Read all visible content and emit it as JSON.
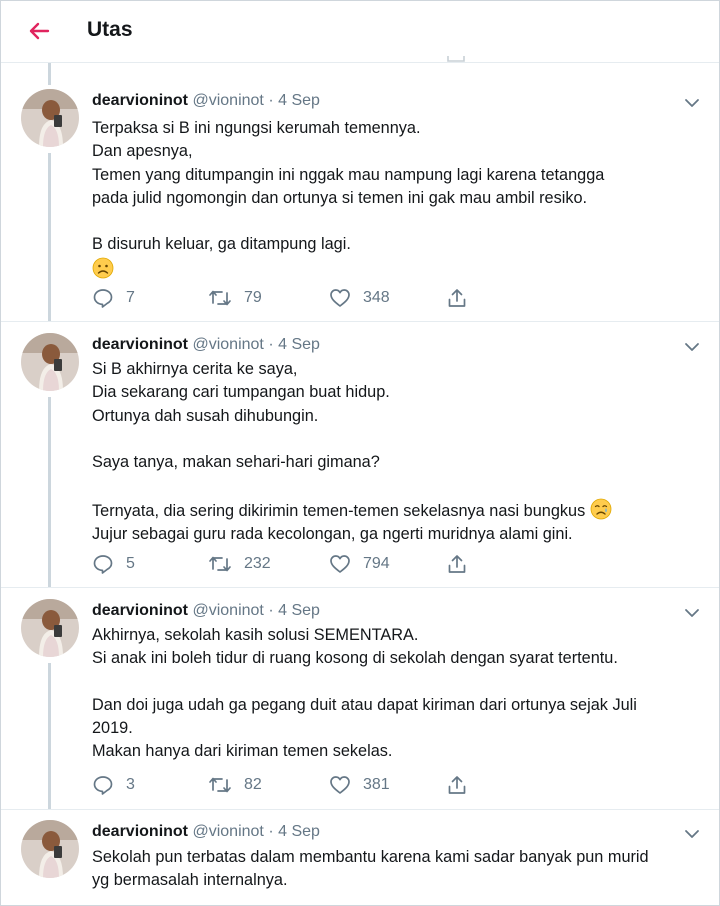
{
  "header": {
    "title": "Utas",
    "accent": "#e0245e"
  },
  "colors": {
    "meta": "#657786",
    "line": "#ccd6dd",
    "divider": "#e6ecf0"
  },
  "tweets": [
    {
      "name": "dearvioninot",
      "handle": "@vioninot",
      "date": "4 Sep",
      "lines": [
        "Terpaksa si B ini ngungsi kerumah temennya.",
        "Dan apesnya,",
        "Temen yang ditumpangin ini nggak mau nampung lagi karena tetangga",
        "pada julid ngomongin dan ortunya si temen ini gak mau ambil resiko.",
        "",
        "B disuruh keluar, ga ditampung lagi."
      ],
      "emoji": "frowning-face",
      "replies": "7",
      "retweets": "79",
      "likes": "348"
    },
    {
      "name": "dearvioninot",
      "handle": "@vioninot",
      "date": "4 Sep",
      "lines": [
        "Si B akhirnya cerita ke saya,",
        "Dia sekarang cari tumpangan buat hidup.",
        "Ortunya dah susah dihubungin.",
        "",
        "Saya tanya, makan sehari-hari gimana?",
        "",
        "Ternyata, dia sering dikirimin temen-temen sekelasnya nasi bungkus",
        "Jujur sebagai guru rada kecolongan, ga ngerti muridnya alami gini."
      ],
      "emoji": "crying-face",
      "replies": "5",
      "retweets": "232",
      "likes": "794"
    },
    {
      "name": "dearvioninot",
      "handle": "@vioninot",
      "date": "4 Sep",
      "lines": [
        "Akhirnya, sekolah kasih solusi SEMENTARA.",
        "Si anak ini boleh tidur di ruang kosong di sekolah dengan syarat tertentu.",
        "",
        "Dan doi juga udah ga pegang duit atau dapat kiriman dari ortunya sejak Juli",
        "2019.",
        "Makan hanya dari kiriman temen sekelas."
      ],
      "replies": "3",
      "retweets": "82",
      "likes": "381"
    },
    {
      "name": "dearvioninot",
      "handle": "@vioninot",
      "date": "4 Sep",
      "lines": [
        "Sekolah pun terbatas dalam membantu karena kami sadar banyak pun murid",
        "yg bermasalah internalnya."
      ]
    }
  ]
}
